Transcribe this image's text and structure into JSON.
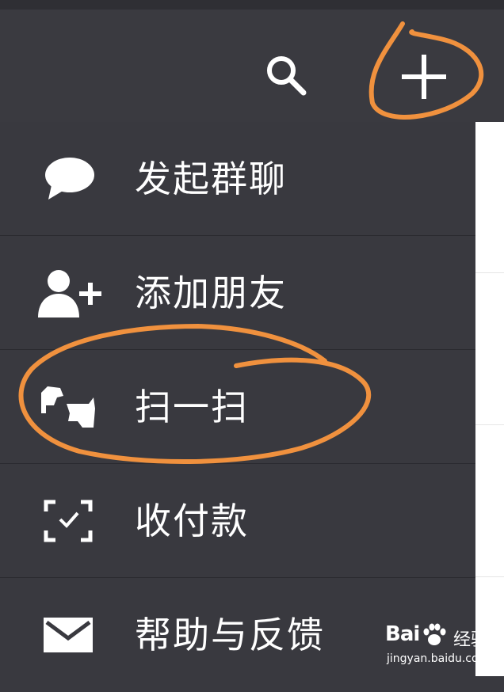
{
  "theme": {
    "menu_bg": "#39393f",
    "annotation_color": "#f0913e",
    "icon_color": "#ffffff"
  },
  "topbar": {
    "search_icon": "search-icon",
    "add_icon": "plus-icon"
  },
  "menu": {
    "items": [
      {
        "label": "发起群聊",
        "icon": "chat-bubble-icon"
      },
      {
        "label": "添加朋友",
        "icon": "add-friend-icon"
      },
      {
        "label": "扫一扫",
        "icon": "scan-icon"
      },
      {
        "label": "收付款",
        "icon": "payment-scan-icon"
      },
      {
        "label": "帮助与反馈",
        "icon": "envelope-icon"
      }
    ]
  },
  "watermark": {
    "brand": "Bai",
    "brand_cn": "经验",
    "url": "jingyan.baidu.com"
  }
}
